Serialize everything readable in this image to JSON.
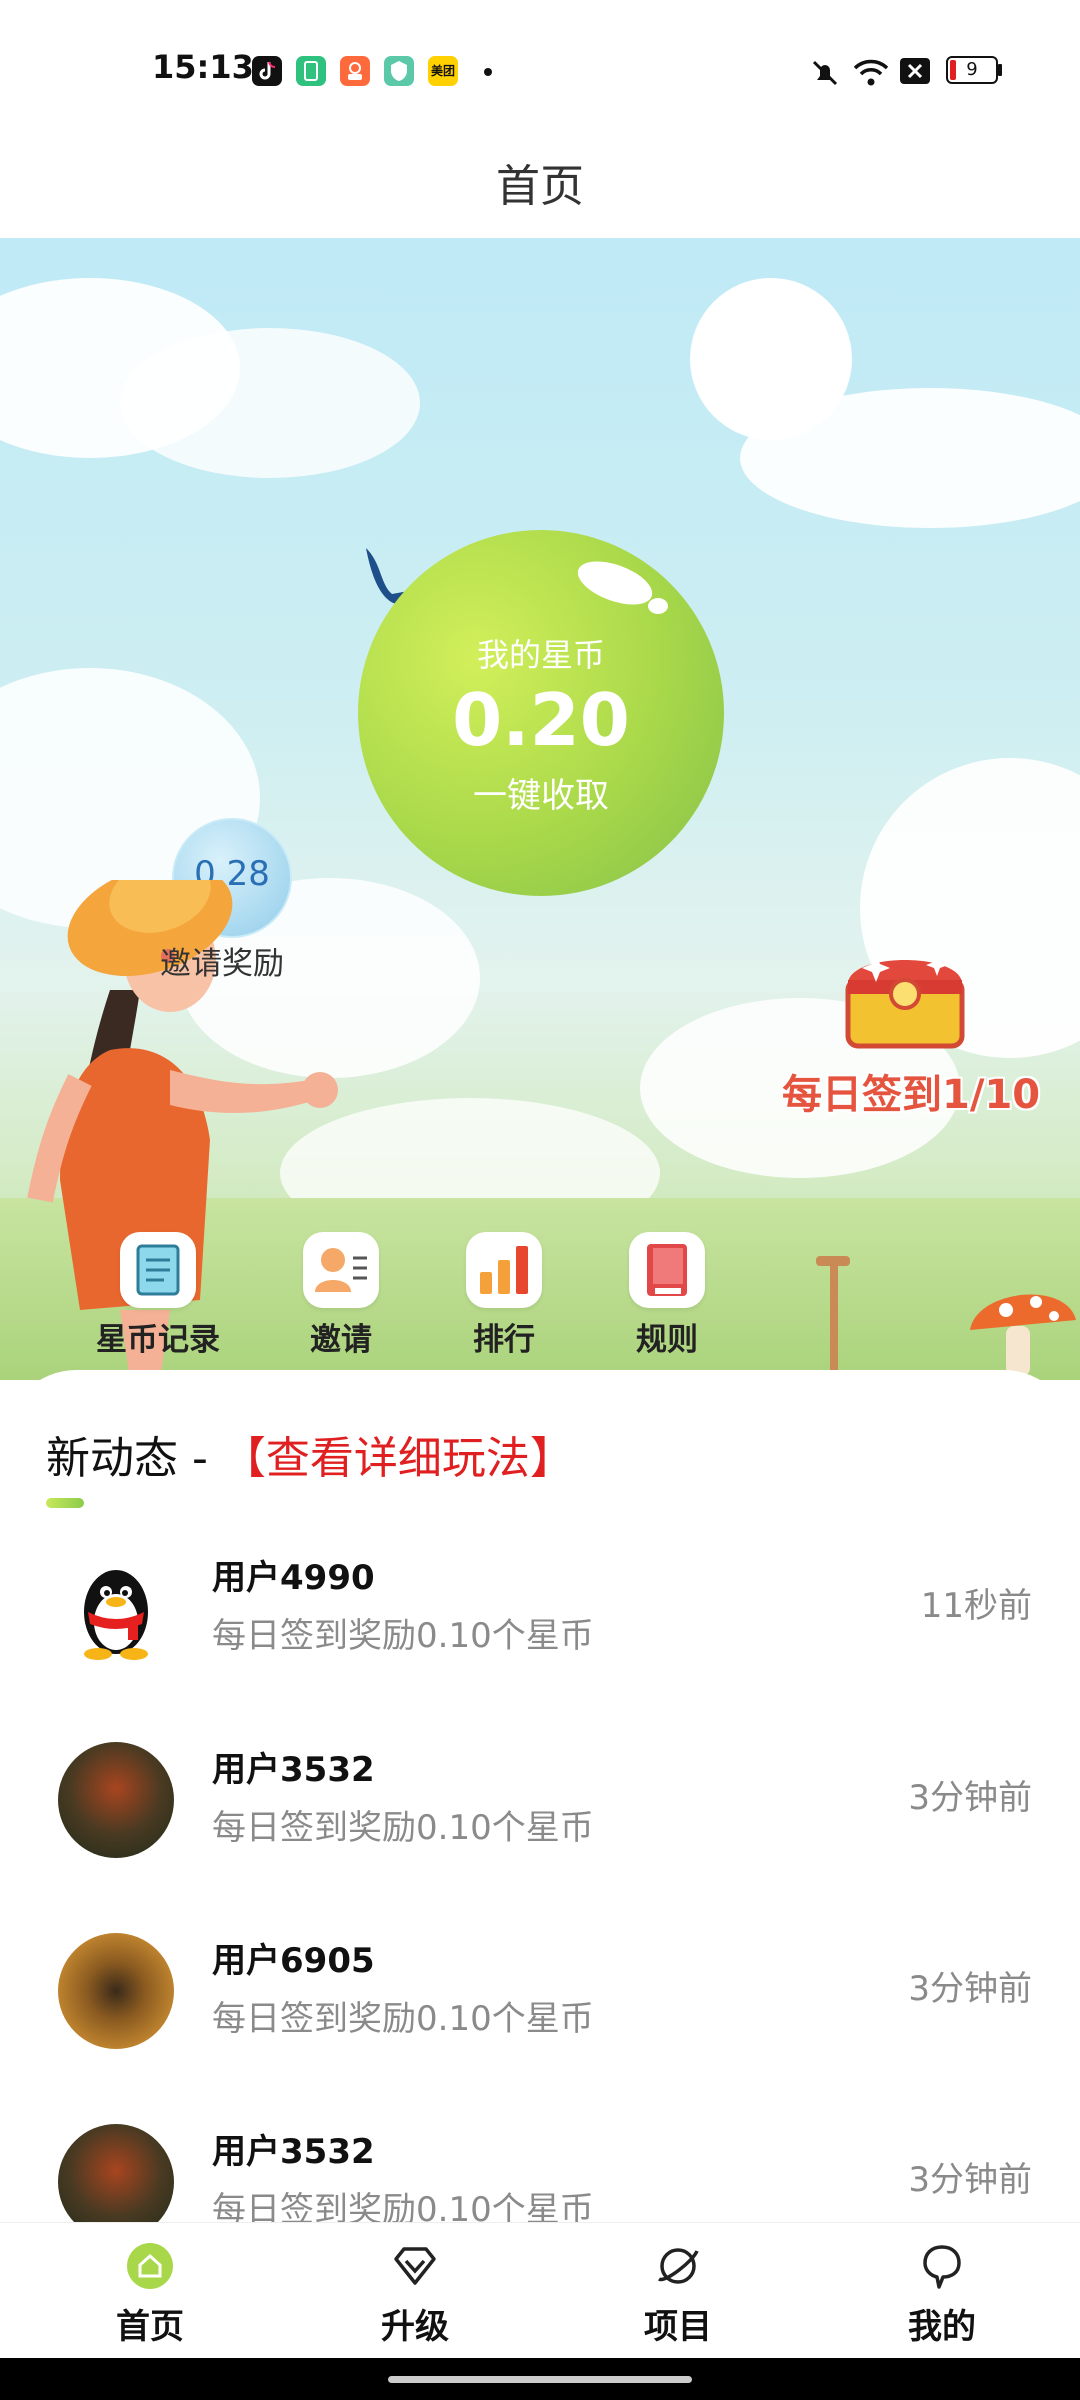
{
  "status_bar": {
    "time": "15:13",
    "icons": [
      "tiktok-icon",
      "green-app-icon",
      "orange-app-icon",
      "shield-app-icon",
      "meituan-icon",
      "dot-icon"
    ],
    "meituan_text": "美团",
    "battery_level": "9"
  },
  "header": {
    "title": "首页"
  },
  "hero": {
    "coin_label": "我的星币",
    "coin_value": "0.20",
    "coin_action": "一键收取",
    "bubble_value": "0.28",
    "bubble_label": "邀请奖励",
    "checkin_label": "每日签到1/10"
  },
  "quick_menu": [
    {
      "label": "星币记录",
      "icon": "record-icon"
    },
    {
      "label": "邀请",
      "icon": "invite-icon"
    },
    {
      "label": "排行",
      "icon": "ranking-icon"
    },
    {
      "label": "规则",
      "icon": "rules-book-icon"
    }
  ],
  "feed": {
    "title": "新动态 - ",
    "link": "【查看详细玩法】",
    "items": [
      {
        "user": "用户4990",
        "desc": "每日签到奖励0.10个星币",
        "time": "11秒前",
        "avatar": "qq-penguin"
      },
      {
        "user": "用户3532",
        "desc": "每日签到奖励0.10个星币",
        "time": "3分钟前",
        "avatar": "photo-red-leaves"
      },
      {
        "user": "用户6905",
        "desc": "每日签到奖励0.10个星币",
        "time": "3分钟前",
        "avatar": "photo-sunset-person"
      },
      {
        "user": "用户3532",
        "desc": "每日签到奖励0.10个星币",
        "time": "3分钟前",
        "avatar": "photo-red-leaves"
      }
    ]
  },
  "tabs": [
    {
      "label": "首页",
      "icon": "home-icon",
      "active": true
    },
    {
      "label": "升级",
      "icon": "diamond-icon",
      "active": false
    },
    {
      "label": "项目",
      "icon": "planet-icon",
      "active": false
    },
    {
      "label": "我的",
      "icon": "profile-icon",
      "active": false
    }
  ],
  "colors": {
    "accent_green": "#a8d84a",
    "link_red": "#e02020",
    "checkin_red": "#e5543e",
    "muted_text": "#8a8a8a"
  }
}
